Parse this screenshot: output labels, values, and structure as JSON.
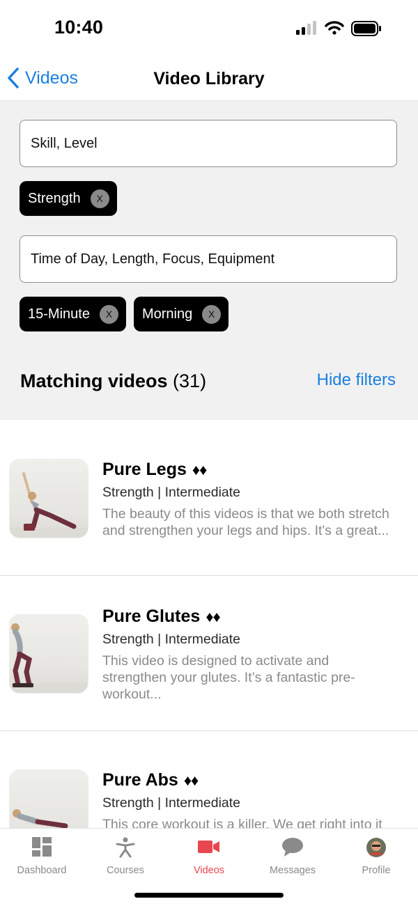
{
  "status_bar": {
    "time": "10:40"
  },
  "nav": {
    "back_label": "Videos",
    "title": "Video Library"
  },
  "filters": {
    "skill_field": "Skill, Level",
    "skill_chips": [
      "Strength"
    ],
    "time_field": "Time of Day, Length, Focus, Equipment",
    "time_chips": [
      "15-Minute",
      "Morning"
    ],
    "chip_remove": "X"
  },
  "results": {
    "label": "Matching videos",
    "count": "(31)",
    "hide_filters": "Hide filters"
  },
  "videos": [
    {
      "title": "Pure Legs",
      "difficulty": "♦♦",
      "meta": "Strength | Intermediate",
      "desc1": "The beauty of this videos is that we both stretch",
      "desc2": "and strengthen your legs and hips. It's a great..."
    },
    {
      "title": "Pure Glutes",
      "difficulty": "♦♦",
      "meta": "Strength | Intermediate",
      "desc1": "This video is designed to activate and",
      "desc2": "strengthen your glutes. It’s a fantastic pre-",
      "desc3": "workout..."
    },
    {
      "title": "Pure Abs",
      "difficulty": "♦♦",
      "meta": "Strength | Intermediate",
      "desc1": "This core workout is a killer. We get right into it"
    }
  ],
  "tabs": [
    {
      "label": "Dashboard",
      "icon": "dashboard-icon"
    },
    {
      "label": "Courses",
      "icon": "person-stretch-icon"
    },
    {
      "label": "Videos",
      "icon": "video-camera-icon"
    },
    {
      "label": "Messages",
      "icon": "chat-bubble-icon"
    },
    {
      "label": "Profile",
      "icon": "avatar"
    }
  ],
  "colors": {
    "accent": "#1a7fe0",
    "active_tab": "#e8474f",
    "chip_bg": "#000000",
    "filter_bg": "#f1f1f1"
  }
}
